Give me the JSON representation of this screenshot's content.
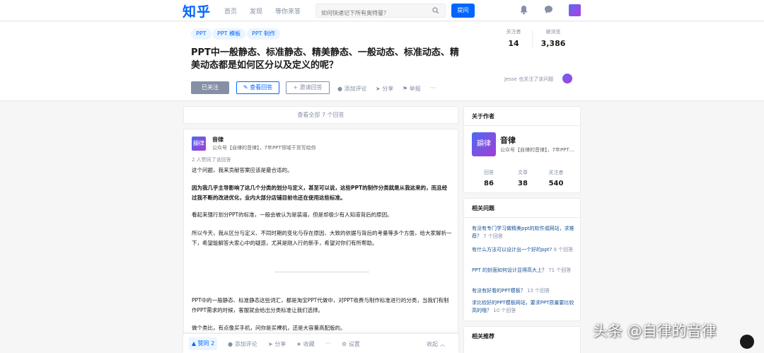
{
  "nav": {
    "logo": "知乎",
    "links": [
      "首页",
      "发现",
      "等你来答"
    ],
    "search_placeholder": "如何快速记下所有奥特曼？",
    "ask_label": "提问"
  },
  "question": {
    "tags": [
      "PPT",
      "PPT 模板",
      "PPT 制作"
    ],
    "title": "PPT中一般静态、标准静态、精美静态、一般动态、标准动态、精美动态都是如何区分以及定义的呢？",
    "followed_label": "已关注",
    "view_answers_label": "查看回答",
    "invite_label": "邀请回答",
    "comment_label": "添加评论",
    "share_label": "分享",
    "report_label": "举报",
    "more_label": "···",
    "stats": [
      {
        "label": "关注者",
        "value": "14"
      },
      {
        "label": "被浏览",
        "value": "3,386"
      }
    ],
    "follower_note": "Jesse 也关注了该问题"
  },
  "feed": {
    "view_all": "查看全部 7 个回答"
  },
  "answer": {
    "author_name": "音律",
    "avatar_text": "韻律",
    "author_bio": "公众号【自律的音律】，7年PPT领域干货写给你",
    "votes_note": "2 人赞同了该回答",
    "paragraphs": [
      "这个问题，我来贡献答案应该是最合适的。",
      "因为我几乎主导影响了这几个分类的划分与定义，甚至可以说，这些PPT的制作分类就是从我这来的，而且经过我不断的改进优化，业内大部分店铺目前也还在使用这些标准。",
      "看起来强行划分PPT的标准，一般会被认为是装逼，但是却极少有人知道背后的原因。",
      "所以今天，我从区分与定义、不同时期的变化与存在原因、大致的依据与背后的考量等多个方面，给大家解析一下，希望能解答大家心中的疑惑，尤其是刚入行的新手，希望对你们有所帮助。",
      "PPT中的一般静态、标准静态这些词汇，都是淘宝PPT代做中，对PPT收费与制作标准进行的分类，当我们有制作PPT需求的时候，客服就会给出分类标准让我们选择。",
      "做个类比，有点像买手机，问你是买裸机，还是大容量高配版的。"
    ]
  },
  "actionbar": {
    "vote_label": "赞同 2",
    "comment_label": "添加评论",
    "share_label": "分享",
    "collect_label": "收藏",
    "more_label": "···",
    "settings_label": "设置",
    "collapse_label": "收起"
  },
  "sidebar": {
    "author_title": "关于作者",
    "author_name": "音律",
    "author_bio": "公众号【自律的音律】，7年PPT领域干货写给你",
    "author_stats": [
      {
        "label": "回答",
        "value": "86"
      },
      {
        "label": "文章",
        "value": "38"
      },
      {
        "label": "关注者",
        "value": "540"
      }
    ],
    "related_title": "相关问题",
    "related": [
      {
        "text": "有没有专门学习做精美ppt的软件或网站，求推荐？",
        "count": "7 个回答"
      },
      {
        "text": "有什么方法可以设计出一个好的ppt?",
        "count": "8 个回答"
      },
      {
        "text": "PPT 的封面如何设计显得高大上？",
        "count": "71 个回答"
      },
      {
        "text": "有没有好看的PPT模板？",
        "count": "13 个回答"
      },
      {
        "text": "求比较好的PPT模板网站，要求PPT质量要比较高的哦？",
        "count": "10 个回答"
      }
    ],
    "recommend_title": "相关推荐"
  },
  "watermark": "头条 @自律的音律",
  "colors": {
    "brand": "#0066ff",
    "muted": "#8590a6",
    "link": "#175199"
  }
}
